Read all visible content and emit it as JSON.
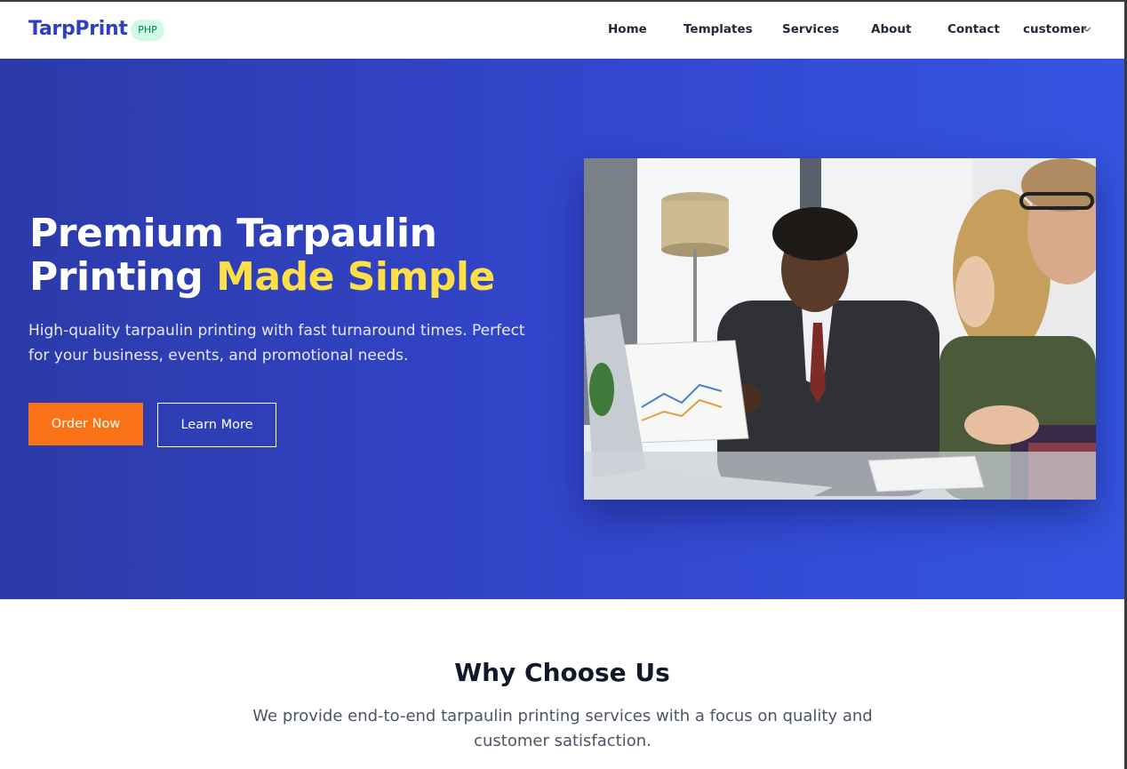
{
  "brand": {
    "name": "TarpPrint",
    "badge": "PHP"
  },
  "nav": {
    "home": "Home",
    "templates": "Templates",
    "services": "Services",
    "about": "About",
    "contact": "Contact",
    "user": "customer",
    "user_icon": "chevron-down-icon"
  },
  "hero": {
    "title_line1": "Premium Tarpaulin",
    "title_line2_plain": "Printing ",
    "title_line2_accent": "Made Simple",
    "subtitle": "High-quality tarpaulin printing with fast turnaround times. Perfect for your business, events, and promotional needs.",
    "primary_button": "Order Now",
    "secondary_button": "Learn More"
  },
  "why": {
    "title": "Why Choose Us",
    "description": "We provide end-to-end tarpaulin printing services with a focus on quality and customer satisfaction."
  },
  "colors": {
    "brand": "#2f3fbf",
    "hero_start": "#2c3aa8",
    "hero_end": "#3554e0",
    "accent": "#fde047",
    "primary_button": "#f97316",
    "badge_bg": "#d1fae5"
  }
}
